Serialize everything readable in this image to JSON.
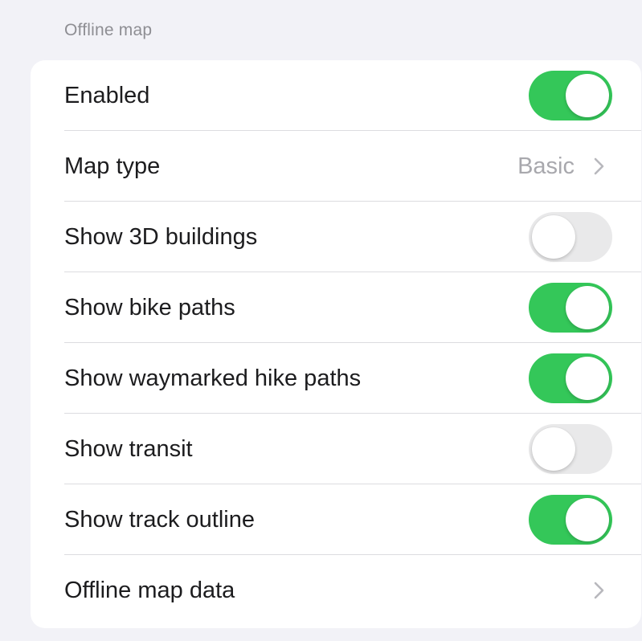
{
  "section": {
    "title": "Offline map"
  },
  "rows": [
    {
      "label": "Enabled",
      "control": "toggle",
      "on": true
    },
    {
      "label": "Map type",
      "control": "disclosure",
      "value": "Basic"
    },
    {
      "label": "Show 3D buildings",
      "control": "toggle",
      "on": false
    },
    {
      "label": "Show bike paths",
      "control": "toggle",
      "on": true
    },
    {
      "label": "Show waymarked hike paths",
      "control": "toggle",
      "on": true
    },
    {
      "label": "Show transit",
      "control": "toggle",
      "on": false
    },
    {
      "label": "Show track outline",
      "control": "toggle",
      "on": true
    },
    {
      "label": "Offline map data",
      "control": "disclosure"
    }
  ],
  "colors": {
    "background": "#f2f2f7",
    "card": "#ffffff",
    "toggle_on": "#34c759",
    "toggle_off": "#e9e9ea",
    "secondary_text": "#a8a8ad",
    "section_header": "#8e8e93"
  },
  "icons": {
    "disclosure": "chevron-right-icon"
  }
}
